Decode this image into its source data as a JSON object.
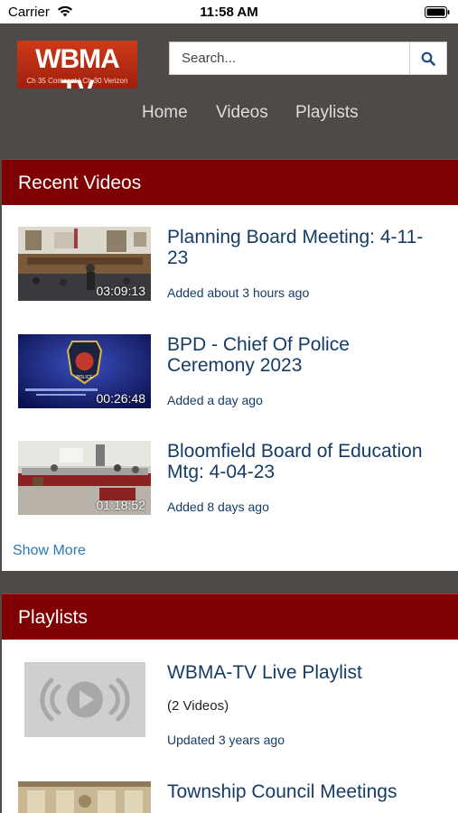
{
  "status_bar": {
    "carrier": "Carrier",
    "time": "11:58 AM"
  },
  "header": {
    "logo_main": "WBMA TV",
    "logo_sub": "Ch 35 Comcast | Ch 30 Verizon",
    "search_placeholder": "Search...",
    "nav": [
      "Home",
      "Videos",
      "Playlists"
    ]
  },
  "recent_videos": {
    "title": "Recent Videos",
    "items": [
      {
        "title": "Planning Board Meeting: 4-11-23",
        "added": "Added about 3 hours ago",
        "duration": "03:09:13"
      },
      {
        "title": "BPD - Chief Of Police Ceremony 2023",
        "added": "Added a day ago",
        "duration": "00:26:48"
      },
      {
        "title": "Bloomfield Board of Education Mtg: 4-04-23",
        "added": "Added 8 days ago",
        "duration": "01:18:52"
      }
    ],
    "show_more": "Show More"
  },
  "playlists": {
    "title": "Playlists",
    "items": [
      {
        "title": "WBMA-TV Live Playlist",
        "count": "(2 Videos)",
        "updated": "Updated 3 years ago"
      },
      {
        "title": "Township Council Meetings"
      }
    ]
  },
  "colors": {
    "header_bg": "#4d4a48",
    "section_red": "#7f0000",
    "link_blue": "#143c66",
    "show_more_blue": "#2a78b8"
  },
  "thumbnail_badge_text": "BLOOMFIELD POLICE"
}
